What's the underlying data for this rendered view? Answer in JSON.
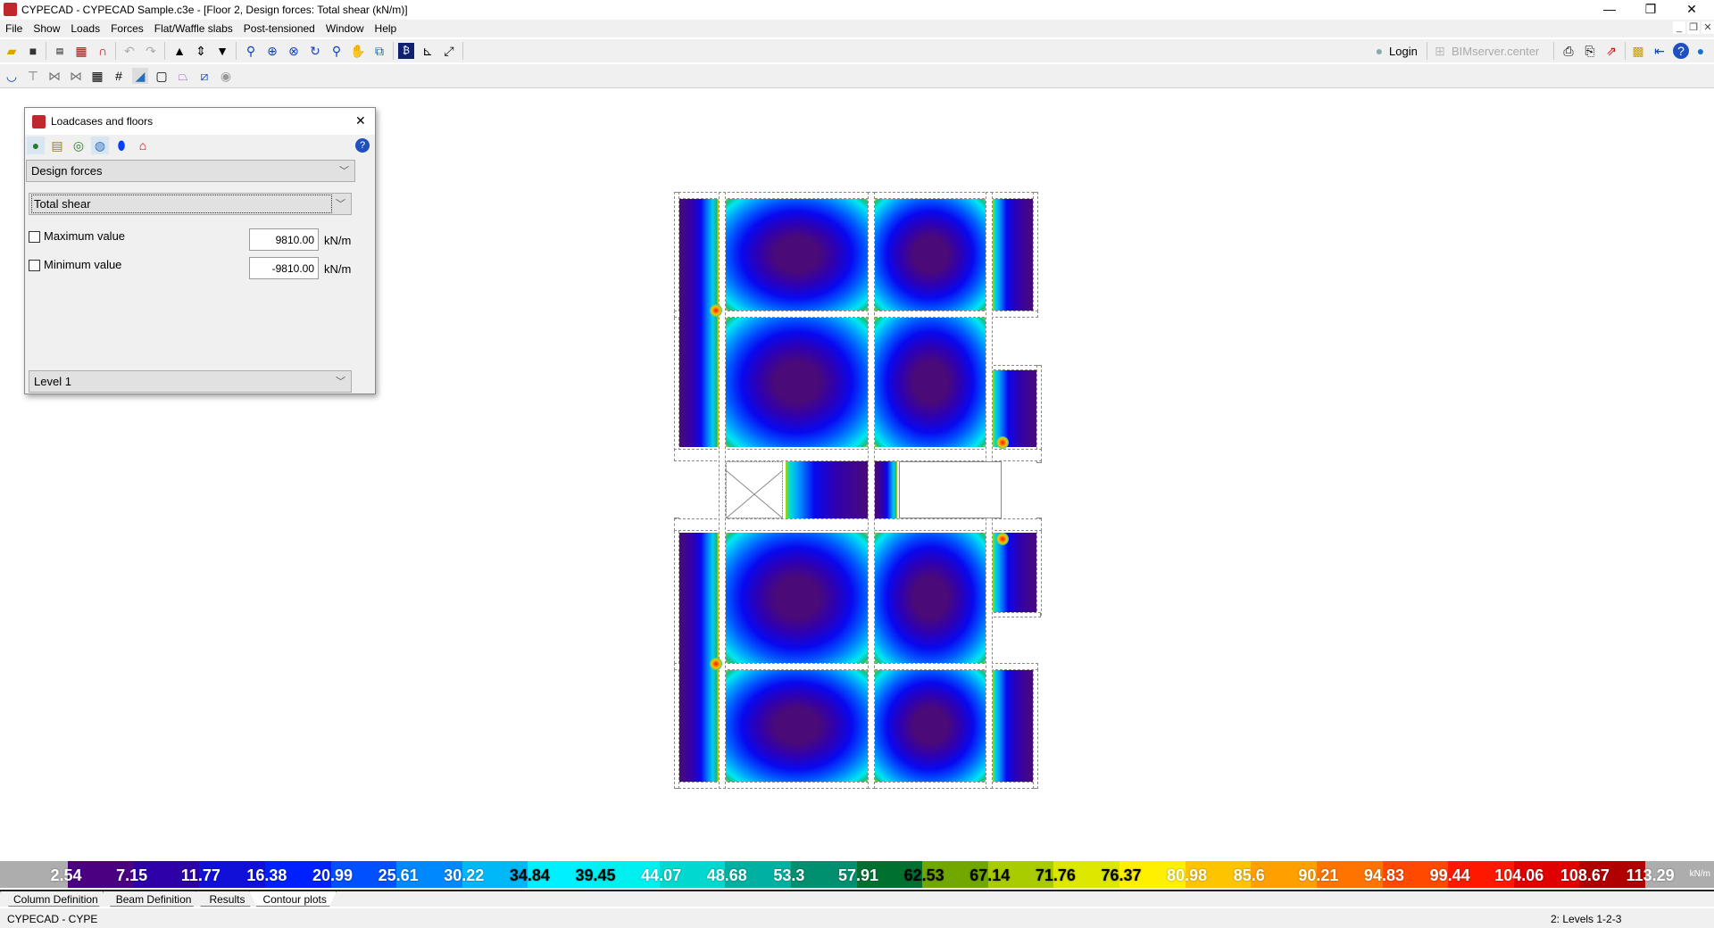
{
  "window": {
    "title": "CYPECAD - CYPECAD Sample.c3e - [Floor 2, Design forces: Total shear (kN/m)]",
    "minimize": "—",
    "restore": "❐",
    "close": "✕"
  },
  "menu": [
    "File",
    "Show",
    "Loads",
    "Forces",
    "Flat/Waffle slabs",
    "Post-tensioned",
    "Window",
    "Help"
  ],
  "toolbar1": {
    "icons": [
      "open-icon",
      "save-icon",
      "dxf-dwg-icon",
      "dxf-layers-icon",
      "magnet-icon",
      "undo-icon",
      "redo-icon",
      "floor-up-icon",
      "floor-select-icon",
      "floor-down-icon",
      "zoom-window-icon",
      "zoom-all-icon",
      "zoom-x2-icon",
      "redraw-icon",
      "zoom-previous-icon",
      "pan-icon",
      "window-view-icon",
      "find-icon",
      "angle-icon",
      "snap-icon"
    ],
    "login": "Login",
    "bimserver": "BIMserver.center",
    "right_icons": [
      "print-icon",
      "print-preview-icon",
      "export-icon",
      "job-settings-icon",
      "folder-icon",
      "help-icon",
      "web-icon"
    ]
  },
  "toolbar2": {
    "icons": [
      "slab-icon",
      "column-icon",
      "beam-icon",
      "beam-delete-icon",
      "view-grid-icon",
      "edit-grid-icon",
      "contour-icon",
      "comment-icon",
      "panel-icon",
      "ramp-icon",
      "hidden-icon"
    ]
  },
  "dialog": {
    "title": "Loadcases and floors",
    "close": "✕",
    "help": "?",
    "result_type": "Design forces",
    "component": "Total shear",
    "max_label": "Maximum value",
    "max_value": "9810.00",
    "min_label": "Minimum value",
    "min_value": "-9810.00",
    "unit": "kN/m",
    "level": "Level 1",
    "icons": [
      "contour-fill-icon",
      "numeric-values-icon",
      "isolines-icon",
      "settings-icon",
      "color-map-icon",
      "view-3d-icon"
    ]
  },
  "legend": {
    "unit": "kN/m",
    "values": [
      "2.54",
      "7.15",
      "11.77",
      "16.38",
      "20.99",
      "25.61",
      "30.22",
      "34.84",
      "39.45",
      "44.07",
      "48.68",
      "53.3",
      "57.91",
      "62.53",
      "67.14",
      "71.76",
      "76.37",
      "80.98",
      "85.6",
      "90.21",
      "94.83",
      "99.44",
      "104.06",
      "108.67",
      "113.29"
    ],
    "colors": [
      "#4b0082",
      "#2e00a8",
      "#1010d8",
      "#0020ff",
      "#0050ff",
      "#0088ff",
      "#00b8f8",
      "#00f0ff",
      "#00f0f0",
      "#00d8d0",
      "#00b0a0",
      "#009070",
      "#007030",
      "#70a800",
      "#a8cc00",
      "#dce800",
      "#fff000",
      "#ffc400",
      "#ffa000",
      "#ff7400",
      "#ff4800",
      "#ff1800",
      "#e00000",
      "#b00000",
      "#800000"
    ],
    "label_colors": [
      "#fff",
      "#fff",
      "#fff",
      "#fff",
      "#fff",
      "#fff",
      "#fff",
      "#000",
      "#000",
      "#fff",
      "#fff",
      "#fff",
      "#fff",
      "#000",
      "#000",
      "#000",
      "#000",
      "#fff",
      "#fff",
      "#fff",
      "#fff",
      "#fff",
      "#fff",
      "#fff",
      "#fff"
    ]
  },
  "tabs": [
    "Column Definition",
    "Beam Definition",
    "Results",
    "Contour plots"
  ],
  "status": {
    "left": "CYPECAD - CYPE",
    "right": "2: Levels 1-2-3"
  }
}
